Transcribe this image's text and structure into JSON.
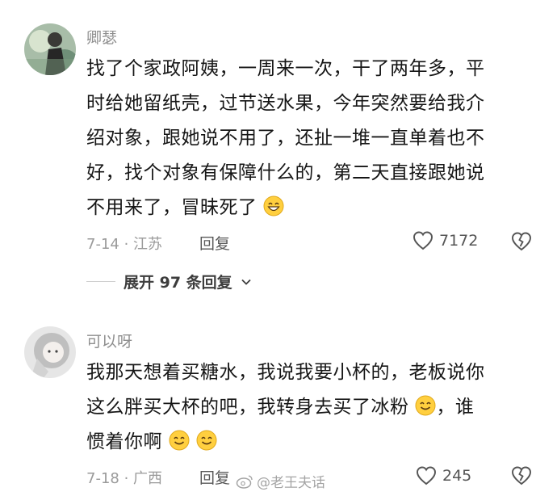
{
  "comments": [
    {
      "username": "卿瑟",
      "lines": [
        "找了个家政阿姨，一周来一次，干了两年多，平",
        "时给她留纸壳，过节送水果，今年突然要给我介",
        "绍对象，跟她说不用了，还扯一堆一直单着也不",
        "好，找个对象有保障什么的，第二天直接跟她说",
        "不用来了，冒昧死了"
      ],
      "date_location": "7-14 · 江苏",
      "reply_label": "回复",
      "like_count": "7172",
      "expand_label": "展开 97 条回复"
    },
    {
      "username": "可以呀",
      "lines": [
        "我那天想着买糖水，我说我要小杯的，老板说你",
        "这么胖买大杯的吧，我转身去买了冰粉",
        "，谁",
        "惯着你啊"
      ],
      "date_location": "7-18 · 广西",
      "reply_label": "回复",
      "like_count": "245"
    }
  ],
  "watermark": "@老王夫话",
  "icons": {
    "like": "heart-outline-icon",
    "dislike": "broken-heart-icon",
    "expand": "chevron-down-icon",
    "emoji": "grinning-face-icon"
  }
}
